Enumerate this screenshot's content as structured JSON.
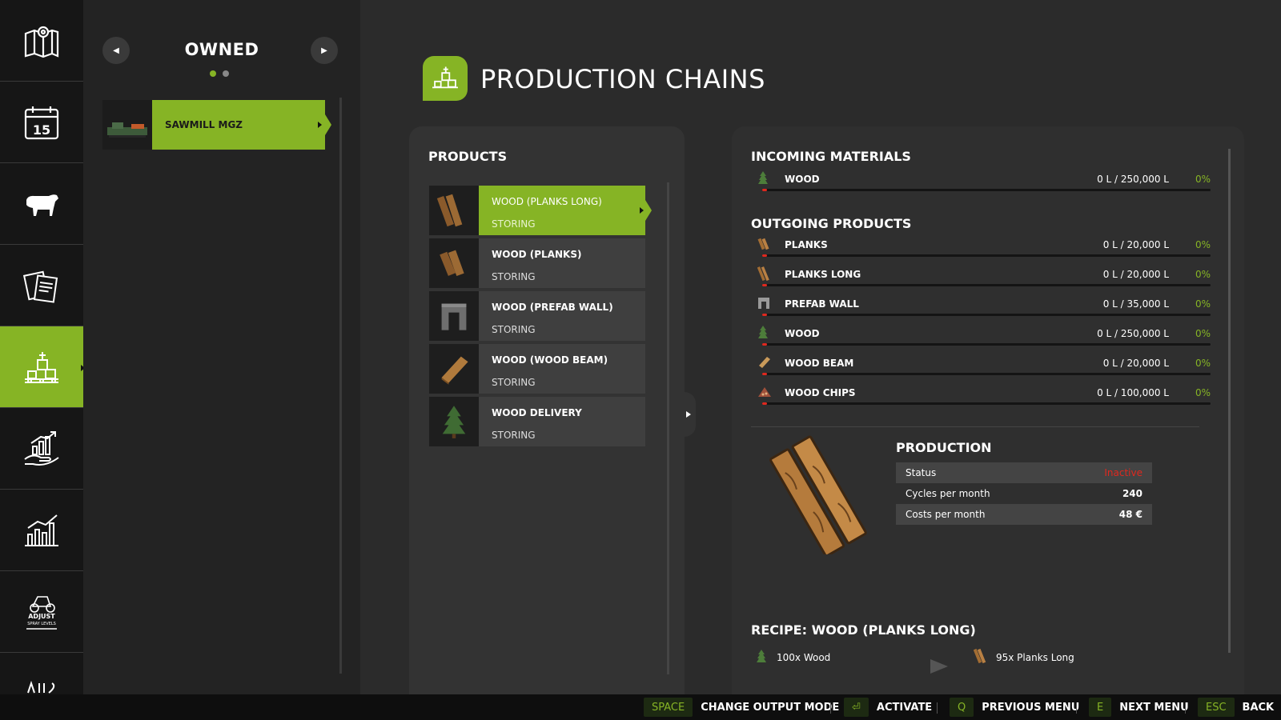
{
  "rail": {
    "items": [
      {
        "name": "map-icon",
        "active": false
      },
      {
        "name": "calendar-icon",
        "label": "15",
        "active": false
      },
      {
        "name": "animals-icon",
        "active": false
      },
      {
        "name": "contracts-icon",
        "active": false
      },
      {
        "name": "production-icon",
        "active": true
      },
      {
        "name": "finances-icon",
        "active": false
      },
      {
        "name": "statistics-icon",
        "active": false
      },
      {
        "name": "adjust-spray-levels-icon",
        "label_top": "ADJUST",
        "label_bottom": "SPRAY LEVELS",
        "active": false
      },
      {
        "name": "more-icon",
        "active": false
      }
    ]
  },
  "owned": {
    "title": "OWNED",
    "page": 1,
    "pages": 2,
    "items": [
      {
        "label": "SAWMILL MGZ",
        "selected": true
      }
    ]
  },
  "header": {
    "title": "PRODUCTION CHAINS"
  },
  "products": {
    "title": "PRODUCTS",
    "items": [
      {
        "name": "WOOD (PLANKS LONG)",
        "status": "STORING",
        "icon": "planks-long-icon",
        "active": true
      },
      {
        "name": "WOOD (PLANKS)",
        "status": "STORING",
        "icon": "planks-icon",
        "active": false
      },
      {
        "name": "WOOD (PREFAB WALL)",
        "status": "STORING",
        "icon": "prefab-wall-icon",
        "active": false
      },
      {
        "name": "WOOD (WOOD BEAM)",
        "status": "STORING",
        "icon": "wood-beam-icon",
        "active": false
      },
      {
        "name": "WOOD DELIVERY",
        "status": "STORING",
        "icon": "tree-icon",
        "active": false
      }
    ]
  },
  "incoming": {
    "title": "INCOMING MATERIALS",
    "items": [
      {
        "name": "WOOD",
        "amount": "0 L / 250,000 L",
        "percent": "0%",
        "fill": 0,
        "icon": "tree-icon"
      }
    ]
  },
  "outgoing": {
    "title": "OUTGOING PRODUCTS",
    "items": [
      {
        "name": "PLANKS",
        "amount": "0 L / 20,000 L",
        "percent": "0%",
        "fill": 0,
        "icon": "planks-icon"
      },
      {
        "name": "PLANKS LONG",
        "amount": "0 L / 20,000 L",
        "percent": "0%",
        "fill": 0,
        "icon": "planks-long-icon"
      },
      {
        "name": "PREFAB WALL",
        "amount": "0 L / 35,000 L",
        "percent": "0%",
        "fill": 0,
        "icon": "prefab-wall-icon"
      },
      {
        "name": "WOOD",
        "amount": "0 L / 250,000 L",
        "percent": "0%",
        "fill": 0,
        "icon": "tree-icon"
      },
      {
        "name": "WOOD BEAM",
        "amount": "0 L / 20,000 L",
        "percent": "0%",
        "fill": 0,
        "icon": "wood-beam-icon"
      },
      {
        "name": "WOOD CHIPS",
        "amount": "0 L / 100,000 L",
        "percent": "0%",
        "fill": 0,
        "icon": "wood-chips-icon"
      }
    ]
  },
  "production": {
    "title": "PRODUCTION",
    "rows": [
      {
        "key": "Status",
        "value": "Inactive",
        "status_color": "#e0281e"
      },
      {
        "key": "Cycles per month",
        "value": "240"
      },
      {
        "key": "Costs per month",
        "value": "48 €"
      }
    ]
  },
  "recipe": {
    "title": "RECIPE: WOOD (PLANKS LONG)",
    "input": "100x Wood",
    "output": "95x Planks Long"
  },
  "bottom_bar": {
    "hints": [
      {
        "key": "SPACE",
        "action": "CHANGE OUTPUT MODE"
      },
      {
        "key": "⏎",
        "action": "ACTIVATE"
      },
      {
        "key": "Q",
        "action": "PREVIOUS MENU"
      },
      {
        "key": "E",
        "action": "NEXT MENU"
      },
      {
        "key": "ESC",
        "action": "BACK"
      }
    ]
  },
  "colors": {
    "accent": "#86b425",
    "alert": "#e0281e",
    "bg": "#2b2b2b"
  }
}
